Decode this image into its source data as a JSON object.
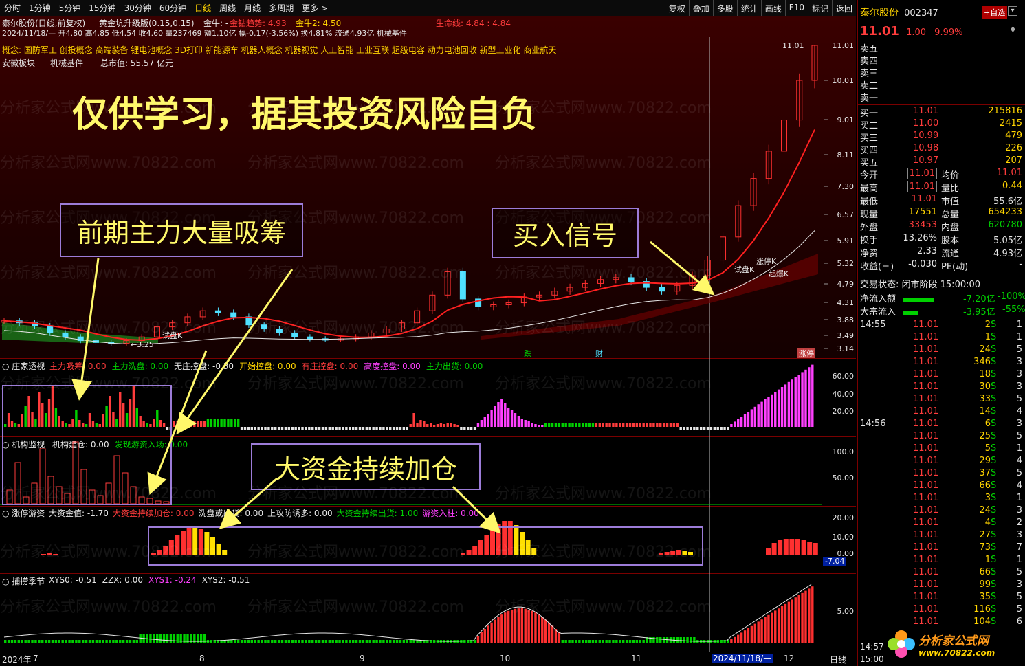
{
  "toolbar": {
    "periods": [
      "分时",
      "1分钟",
      "5分钟",
      "15分钟",
      "30分钟",
      "60分钟",
      "日线",
      "周线",
      "月线",
      "多周期",
      "更多 >"
    ],
    "active_period": "日线",
    "tools": [
      "复权",
      "叠加",
      "多股",
      "统计",
      "画线",
      "F10",
      "标记",
      "返回"
    ]
  },
  "chart_header": {
    "line1": "泰尔股份(日线,前复权)",
    "indicator_name": "黄金坑升级版(0.15,0.15)",
    "jinniu": "金牛: -",
    "jinzuan": "金钻趋势: 4.93",
    "jinniu2": "金牛2: 4.50",
    "shengming": "生命线: 4.84 : 4.84",
    "ohlc": "2024/11/18/— 开4.80 高4.85 低4.54 收4.60 量237469 额1.10亿 幅-0.17(-3.56%) 换4.81% 流通4.93亿 机械基件",
    "concept": "概念:  国防军工 创投概念 高端装备 锂电池概念 3D打印 新能源车 机器人概念 机器视觉 人工智能 工业互联 超级电容 动力电池回收 新型工业化 商业航天",
    "region": "安徽板块",
    "industry": "机械基件",
    "market_cap": "总市值:  55.57 亿元"
  },
  "watermark_text": "分析家公式网www.70822.com",
  "annotations": {
    "disclaimer": "仅供学习，据其投资风险自负",
    "accumulate": "前期主力大量吸筹",
    "buy_signal": "买入信号",
    "add_position": "大资金持续加仓"
  },
  "main_chart": {
    "price_axis": [
      "11.01",
      "10.01",
      "9.01",
      "8.11",
      "7.30",
      "6.57",
      "5.91",
      "5.32",
      "4.79",
      "4.31",
      "3.88",
      "3.49",
      "3.14"
    ],
    "high_label": "11.01",
    "low_label": "3.25",
    "markers": {
      "shipan1": "试盘K",
      "shipan2": "试盘K",
      "zhangting": "涨停K",
      "qibao": "起爆K",
      "die": "跌",
      "cai": "财",
      "zhangting2": "涨停"
    },
    "candles_desc": "daily candles, long base 3.3-4.0, rally to 5.9, pullback 4.3-4.8, breakout to 11.01",
    "close_series": [
      3.85,
      3.8,
      3.72,
      3.55,
      3.45,
      3.35,
      3.3,
      3.28,
      3.35,
      3.45,
      3.7,
      3.8,
      3.95,
      4.1,
      4.05,
      3.95,
      3.75,
      3.65,
      3.55,
      3.45,
      3.4,
      3.38,
      3.4,
      3.45,
      3.55,
      3.65,
      3.8,
      4.1,
      4.5,
      5.1,
      4.4,
      4.2,
      4.25,
      4.3,
      4.45,
      4.5,
      4.6,
      4.7,
      4.8,
      4.9,
      4.95,
      4.85,
      4.7,
      4.6,
      4.75,
      5.0,
      5.4,
      6.0,
      6.8,
      7.5,
      8.2,
      9.0,
      10.01,
      11.01
    ],
    "color_up": "#ff3030",
    "color_down": "#4fe0ff"
  },
  "panel_zhuangjia": {
    "title": "庄家透视",
    "fields": [
      {
        "label": "主力吸筹: 0.00",
        "color": "#ff3c3c"
      },
      {
        "label": "主力洗盘: 0.00",
        "color": "#00d000"
      },
      {
        "label": "无庄控盘: -0.30",
        "color": "#e6e6e6"
      },
      {
        "label": "开始控盘: 0.00",
        "color": "#ffd400"
      },
      {
        "label": "有庄控盘: 0.00",
        "color": "#ff3c3c"
      },
      {
        "label": "高度控盘: 0.00",
        "color": "#ff40ff"
      },
      {
        "label": "主力出货: 0.00",
        "color": "#00d000"
      }
    ],
    "axis": [
      "60.00",
      "40.00",
      "20.00"
    ]
  },
  "panel_jigou": {
    "title": "机构监视",
    "fields": [
      {
        "label": "机构建仓: 0.00",
        "color": "#e6e6e6"
      },
      {
        "label": "发现游资入场: 0.00",
        "color": "#00d000"
      }
    ],
    "axis": [
      "100.0",
      "50.00"
    ]
  },
  "panel_zhangting": {
    "title": "涨停游资",
    "fields": [
      {
        "label": "大资金值: -1.70",
        "color": "#e6e6e6"
      },
      {
        "label": "大资金持续加仓: 0.00",
        "color": "#ff3c3c"
      },
      {
        "label": "洗盘或出货: 0.00",
        "color": "#e6e6e6"
      },
      {
        "label": "上攻防诱多: 0.00",
        "color": "#e6e6e6"
      },
      {
        "label": "大资金持续出货: 1.00",
        "color": "#00d000"
      },
      {
        "label": "游资入柱: 0.00",
        "color": "#ff40ff"
      }
    ],
    "axis": [
      "20.00",
      "10.00",
      "0.00"
    ],
    "cursor_value": "-7.04"
  },
  "panel_buzhuo": {
    "title": "捕捞季节",
    "fields": [
      {
        "label": "XYS0: -0.51",
        "color": "#e6e6e6"
      },
      {
        "label": "ZZX: 0.00",
        "color": "#e6e6e6"
      },
      {
        "label": "XYS1: -0.24",
        "color": "#ff40ff"
      },
      {
        "label": "XYS2: -0.51",
        "color": "#e6e6e6"
      }
    ],
    "axis": [
      "5.00"
    ]
  },
  "time_axis": {
    "labels": [
      "2024年",
      "7",
      "8",
      "9",
      "10",
      "11",
      "2024/11/18/—",
      "12"
    ],
    "period": "日线"
  },
  "quote": {
    "name": "泰尔股份",
    "code": "002347",
    "add_btn": "+自选",
    "price": "11.01",
    "change": "1.00",
    "pct": "9.99%",
    "asks": [
      {
        "label": "卖五",
        "price": "",
        "vol": ""
      },
      {
        "label": "卖四",
        "price": "",
        "vol": ""
      },
      {
        "label": "卖三",
        "price": "",
        "vol": ""
      },
      {
        "label": "卖二",
        "price": "",
        "vol": ""
      },
      {
        "label": "卖一",
        "price": "",
        "vol": ""
      }
    ],
    "bids": [
      {
        "label": "买一",
        "price": "11.01",
        "vol": "215816"
      },
      {
        "label": "买二",
        "price": "11.00",
        "vol": "2415"
      },
      {
        "label": "买三",
        "price": "10.99",
        "vol": "479"
      },
      {
        "label": "买四",
        "price": "10.98",
        "vol": "226"
      },
      {
        "label": "买五",
        "price": "10.97",
        "vol": "207"
      }
    ],
    "stats": [
      {
        "l1": "今开",
        "v1": "11.01",
        "l2": "均价",
        "v2": "11.01"
      },
      {
        "l1": "最高",
        "v1": "11.01",
        "l2": "量比",
        "v2": "0.44"
      },
      {
        "l1": "最低",
        "v1": "11.01",
        "l2": "市值",
        "v2": "55.6亿"
      },
      {
        "l1": "现量",
        "v1": "17551",
        "l2": "总量",
        "v2": "654233"
      },
      {
        "l1": "外盘",
        "v1": "33453",
        "l2": "内盘",
        "v2": "620780"
      },
      {
        "l1": "换手",
        "v1": "13.26%",
        "l2": "股本",
        "v2": "5.05亿"
      },
      {
        "l1": "净资",
        "v1": "2.33",
        "l2": "流通",
        "v2": "4.93亿"
      },
      {
        "l1": "收益(三)",
        "v1": "-0.030",
        "l2": "PE(动)",
        "v2": "-"
      }
    ],
    "trade_status": "交易状态: 闭市阶段 15:00:00",
    "netflow": {
      "label": "净流入额",
      "value": "-7.20亿",
      "pct": "-100%"
    },
    "bigflow": {
      "label": "大宗流入",
      "value": "-3.95亿",
      "pct": "-55%"
    },
    "ticks": [
      {
        "time": "14:55",
        "price": "11.01",
        "vol": "2",
        "bs": "S",
        "n": "1"
      },
      {
        "time": "",
        "price": "11.01",
        "vol": "1",
        "bs": "S",
        "n": "1"
      },
      {
        "time": "",
        "price": "11.01",
        "vol": "24",
        "bs": "S",
        "n": "5"
      },
      {
        "time": "",
        "price": "11.01",
        "vol": "346",
        "bs": "S",
        "n": "3"
      },
      {
        "time": "",
        "price": "11.01",
        "vol": "18",
        "bs": "S",
        "n": "3"
      },
      {
        "time": "",
        "price": "11.01",
        "vol": "30",
        "bs": "S",
        "n": "3"
      },
      {
        "time": "",
        "price": "11.01",
        "vol": "33",
        "bs": "S",
        "n": "5"
      },
      {
        "time": "",
        "price": "11.01",
        "vol": "14",
        "bs": "S",
        "n": "4"
      },
      {
        "time": "14:56",
        "price": "11.01",
        "vol": "6",
        "bs": "S",
        "n": "3"
      },
      {
        "time": "",
        "price": "11.01",
        "vol": "25",
        "bs": "S",
        "n": "5"
      },
      {
        "time": "",
        "price": "11.01",
        "vol": "5",
        "bs": "S",
        "n": "1"
      },
      {
        "time": "",
        "price": "11.01",
        "vol": "29",
        "bs": "S",
        "n": "4"
      },
      {
        "time": "",
        "price": "11.01",
        "vol": "37",
        "bs": "S",
        "n": "5"
      },
      {
        "time": "",
        "price": "11.01",
        "vol": "66",
        "bs": "S",
        "n": "4"
      },
      {
        "time": "",
        "price": "11.01",
        "vol": "3",
        "bs": "S",
        "n": "1"
      },
      {
        "time": "",
        "price": "11.01",
        "vol": "24",
        "bs": "S",
        "n": "3"
      },
      {
        "time": "",
        "price": "11.01",
        "vol": "4",
        "bs": "S",
        "n": "2"
      },
      {
        "time": "",
        "price": "11.01",
        "vol": "27",
        "bs": "S",
        "n": "3"
      },
      {
        "time": "",
        "price": "11.01",
        "vol": "73",
        "bs": "S",
        "n": "7"
      },
      {
        "time": "",
        "price": "11.01",
        "vol": "1",
        "bs": "S",
        "n": "1"
      },
      {
        "time": "",
        "price": "11.01",
        "vol": "66",
        "bs": "S",
        "n": "5"
      },
      {
        "time": "",
        "price": "11.01",
        "vol": "99",
        "bs": "S",
        "n": "3"
      },
      {
        "time": "",
        "price": "11.01",
        "vol": "35",
        "bs": "S",
        "n": "5"
      },
      {
        "time": "",
        "price": "11.01",
        "vol": "116",
        "bs": "S",
        "n": "5"
      },
      {
        "time": "",
        "price": "11.01",
        "vol": "104",
        "bs": "S",
        "n": "6"
      }
    ],
    "bottom_time1": "14:57",
    "bottom_time2": "15:00"
  },
  "logo": {
    "name": "分析家公式网",
    "url": "www.70822.com"
  }
}
